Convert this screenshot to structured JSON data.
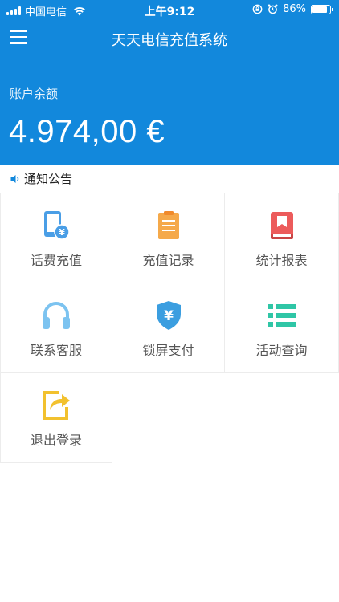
{
  "status_bar": {
    "carrier": "中国电信",
    "time": "上午9:12",
    "battery": "86%",
    "battery_level": 0.86
  },
  "header": {
    "title": "天天电信充值系统"
  },
  "account": {
    "balance_label": "账户余额",
    "balance_value": "4.974,00 €"
  },
  "notice": {
    "label": "通知公告"
  },
  "menu": {
    "items": [
      {
        "label": "话费充值",
        "icon": "phone-recharge-icon",
        "color": "#4a9ee6"
      },
      {
        "label": "充值记录",
        "icon": "clipboard-icon",
        "color": "#f5a94a"
      },
      {
        "label": "统计报表",
        "icon": "book-icon",
        "color": "#ec5b5b"
      },
      {
        "label": "联系客服",
        "icon": "headphones-icon",
        "color": "#7cc3f0"
      },
      {
        "label": "锁屏支付",
        "icon": "shield-yen-icon",
        "color": "#3b9ee0"
      },
      {
        "label": "活动查询",
        "icon": "list-icon",
        "color": "#2fc6a6"
      },
      {
        "label": "退出登录",
        "icon": "logout-icon",
        "color": "#f2c12e"
      }
    ]
  },
  "colors": {
    "primary": "#1288dc"
  }
}
